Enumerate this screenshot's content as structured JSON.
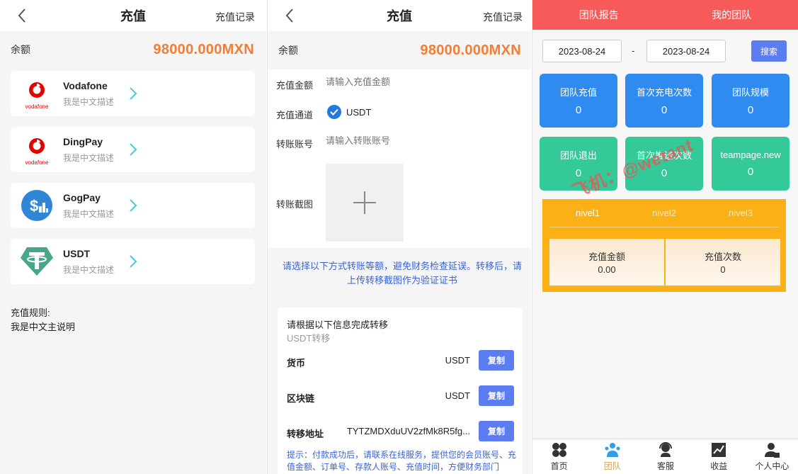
{
  "recharge": {
    "title": "充值",
    "history_link": "充值记录",
    "balance_label": "余额",
    "balance_value": "98000.000MXN",
    "methods": [
      {
        "name": "Vodafone",
        "desc": "我是中文描述",
        "icon": "vodafone-logo"
      },
      {
        "name": "DingPay",
        "desc": "我是中文描述",
        "icon": "vodafone-logo"
      },
      {
        "name": "GogPay",
        "desc": "我是中文描述",
        "icon": "gogpay-logo"
      },
      {
        "name": "USDT",
        "desc": "我是中文描述",
        "icon": "tether-logo"
      }
    ],
    "vodafone_logo_text": "vodafone",
    "rules_title": "充值规则:",
    "rules_text": "我是中文主说明"
  },
  "transfer": {
    "title": "充值",
    "history_link": "充值记录",
    "balance_label": "余额",
    "balance_value": "98000.000MXN",
    "amount_label": "充值金额",
    "amount_placeholder": "请输入充值金额",
    "channel_label": "充值通道",
    "channel_value": "USDT",
    "account_label": "转账账号",
    "account_placeholder": "请输入转账账号",
    "screenshot_label": "转账截图",
    "notice": "请选择以下方式转账等额，避免财务检查延误。转移后，请上传转移截图作为验证证书",
    "info_title": "请根据以下信息完成转移",
    "info_sub": "USDT转移",
    "rows": [
      {
        "label": "货币",
        "value": "USDT",
        "button": "复制"
      },
      {
        "label": "区块链",
        "value": "USDT",
        "button": "复制"
      },
      {
        "label": "转移地址",
        "value": "TYTZMDXduUV2zfMk8R5fg...",
        "button": "复制"
      }
    ],
    "tip": "提示：付款成功后，请联系在线服务，提供您的会员账号、充值金额、订单号、存款人账号、充值时间，方便财务部门"
  },
  "team": {
    "tabs": [
      "团队报告",
      "我的团队"
    ],
    "date_from": "2023-08-24",
    "date_sep": "-",
    "date_to": "2023-08-24",
    "search_label": "搜索",
    "stats": [
      {
        "label": "团队充值",
        "value": "0",
        "color": "#2f8bf0"
      },
      {
        "label": "首次充电次数",
        "value": "0",
        "color": "#2f8bf0"
      },
      {
        "label": "团队规模",
        "value": "0",
        "color": "#2f8bf0"
      },
      {
        "label": "团队退出",
        "value": "0",
        "color": "#33c998"
      },
      {
        "label": "首次推送次数",
        "value": "0",
        "color": "#33c998"
      },
      {
        "label": "teampage.new",
        "value": "0",
        "color": "#33c998"
      }
    ],
    "levels": [
      "nivel1",
      "nivel2",
      "nivel3"
    ],
    "level_stats": [
      {
        "label": "充值金额",
        "value": "0.00"
      },
      {
        "label": "充值次数",
        "value": "0"
      }
    ],
    "watermark": "飞机：@wetant",
    "nav": [
      {
        "label": "首页",
        "icon": "home-icon"
      },
      {
        "label": "团队",
        "icon": "team-icon"
      },
      {
        "label": "客服",
        "icon": "support-icon"
      },
      {
        "label": "收益",
        "icon": "earnings-icon"
      },
      {
        "label": "个人中心",
        "icon": "profile-icon"
      }
    ]
  },
  "colors": {
    "balance_orange": "#f27e33",
    "tab_red": "#f85a5a",
    "button_blue": "#5b7df0",
    "stat_blue": "#2f8bf0",
    "stat_green": "#33c998",
    "level_yellow": "#fbb015",
    "chevron_cyan": "#4cc9d9",
    "notice_blue": "#3a64d6"
  }
}
